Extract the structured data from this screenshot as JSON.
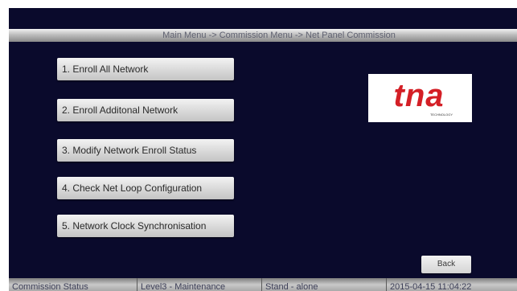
{
  "title_bar": {
    "breadcrumb": "Main Menu -> Commission Menu -> Net Panel Commission"
  },
  "menu": {
    "items": [
      {
        "label": "1. Enroll All Network"
      },
      {
        "label": "2. Enroll Additonal Network"
      },
      {
        "label": "3. Modify Network Enroll Status"
      },
      {
        "label": "4. Check Net Loop Configuration"
      },
      {
        "label": "5. Network Clock Synchronisation"
      }
    ]
  },
  "logo": {
    "name": "tna-logo",
    "wordmark": "tna",
    "tagline": "TECHNOLOGY",
    "brand_color": "#d41f26"
  },
  "back_button": {
    "label": "Back"
  },
  "status_bar": {
    "commission_status": "Commission Status",
    "access_level": "Level3 - Maintenance",
    "mode": "Stand - alone",
    "datetime": "2015-04-15 11:04:22"
  },
  "colors": {
    "background": "#0a0a2c",
    "button_face": "#d6d6d6",
    "text_on_button": "#2a2a2a"
  }
}
